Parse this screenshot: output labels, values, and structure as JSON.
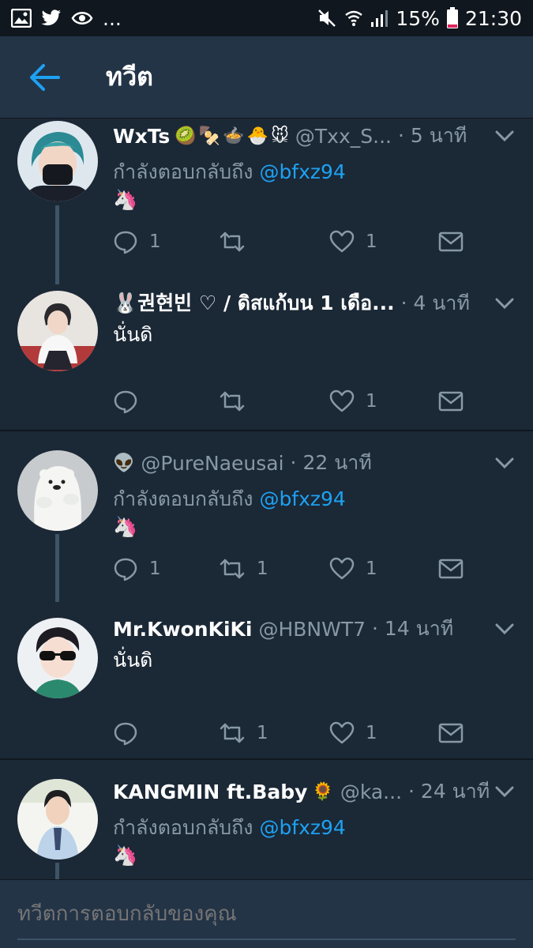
{
  "status_bar": {
    "left_icons": [
      "image-icon",
      "twitter-bird-icon",
      "eye-icon"
    ],
    "overflow": "...",
    "battery_percent": "15%",
    "time": "21:30"
  },
  "header": {
    "title": "ทวีต"
  },
  "tweets": [
    {
      "name": "WxTs",
      "name_emoji": [
        "🥝",
        "🍢",
        "🍲",
        "🐣",
        "🐭"
      ],
      "handle": "@Txx_S...",
      "time": "· 5 นาที",
      "reply_prefix": "กำลังตอบกลับถึง ",
      "reply_mention": "@bfxz94",
      "body": "🦄",
      "counts": {
        "reply": "1",
        "retweet": "",
        "like": "1"
      }
    },
    {
      "name": "🐰권현빈 ♡  / ดิสแก้บน 1 เดือ...",
      "time": "· 4 นาที",
      "body": "นั่นดิ",
      "counts": {
        "reply": "",
        "retweet": "",
        "like": "1"
      }
    },
    {
      "name_emoji": [
        "👽"
      ],
      "handle": "@PureNaeusai",
      "time": "· 22 นาที",
      "reply_prefix": "กำลังตอบกลับถึง ",
      "reply_mention": "@bfxz94",
      "body": "🦄",
      "counts": {
        "reply": "1",
        "retweet": "1",
        "like": "1"
      }
    },
    {
      "name": "Mr.KwonKiKi",
      "handle": "@HBNWT7",
      "time": "· 14 นาที",
      "body": "นั่นดิ",
      "counts": {
        "reply": "",
        "retweet": "1",
        "like": "1"
      }
    },
    {
      "name": "KANGMIN ft.Baby",
      "name_emoji": [
        "🌻"
      ],
      "handle": "@ka...",
      "time": "· 24 นาที",
      "reply_prefix": "กำลังตอบกลับถึง ",
      "reply_mention": "@bfxz94",
      "body": "🦄"
    }
  ],
  "compose": {
    "placeholder": "ทวีตการตอบกลับของคุณ"
  },
  "colors": {
    "background": "#1b2836",
    "header": "#243447",
    "statusbar": "#10171e",
    "accent": "#1da1f2",
    "muted": "#8899a6",
    "battery_low": "#e0245e"
  }
}
